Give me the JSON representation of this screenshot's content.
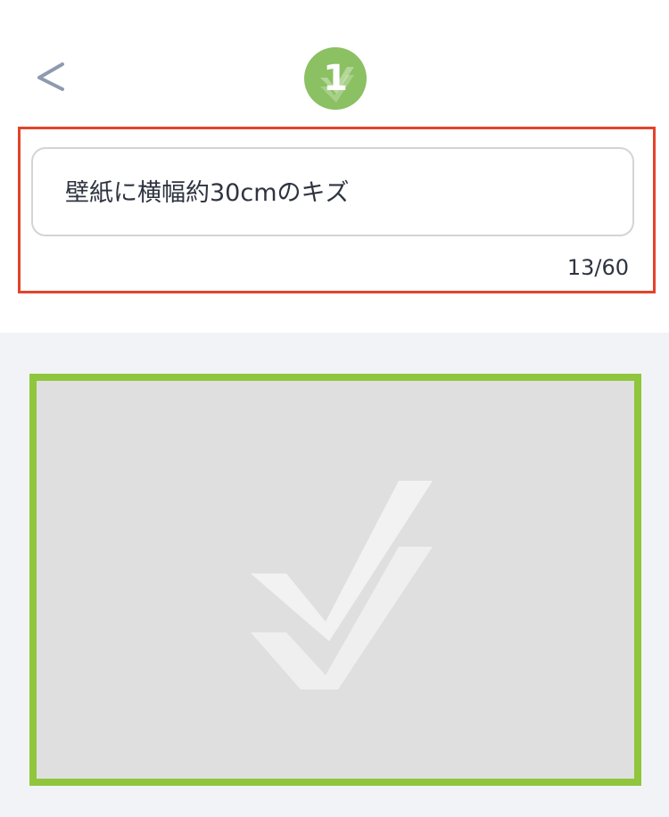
{
  "header": {
    "back_icon": "chevron-left-icon",
    "step_badge": {
      "number": "1",
      "color": "#8bc063",
      "icon": "double-check-icon"
    }
  },
  "input": {
    "value": "壁紙に横幅約30cmのキズ",
    "counter": "13/60",
    "highlight_color": "#e3432a"
  },
  "photo": {
    "placeholder_icon": "double-check-icon",
    "border_color": "#8fc63d",
    "background_color": "#dfdfdf"
  }
}
